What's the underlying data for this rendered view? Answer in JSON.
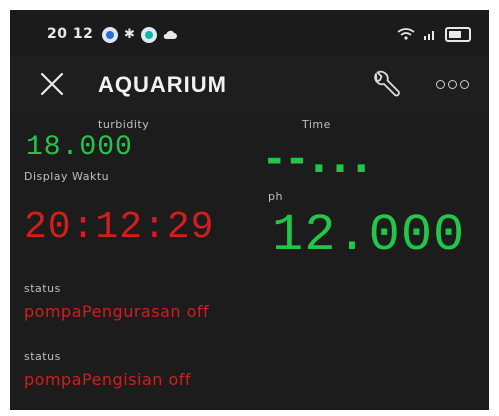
{
  "status_bar": {
    "time": "20 12",
    "left_icons": [
      "app-notification-icon",
      "usb-icon",
      "app-notification-icon",
      "cloud-icon"
    ],
    "right_icons": [
      "wifi-icon",
      "signal-icon",
      "battery-icon"
    ]
  },
  "app_bar": {
    "title": "AQUARIUM",
    "icons": [
      "close-icon",
      "wrench-icon",
      "more-icon"
    ]
  },
  "widgets": {
    "turbidity": {
      "label": "turbidity",
      "value": "18.000"
    },
    "time": {
      "label": "Time",
      "value": "--..."
    },
    "display_waktu": {
      "label": "Display Waktu",
      "value": "20:12:29"
    },
    "ph": {
      "label": "ph",
      "value": "12.000"
    },
    "status1": {
      "label": "status",
      "value": "pompaPengurasan off"
    },
    "status2": {
      "label": "status",
      "value": "pompaPengisian off"
    }
  },
  "colors": {
    "background": "#1c1c1c",
    "green_value": "#22c74a",
    "red_value": "#d11e1e",
    "label_gray": "#bfbfbf"
  }
}
